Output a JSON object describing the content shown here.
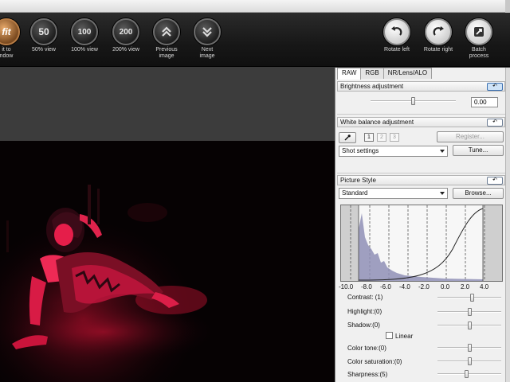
{
  "toolbar": {
    "left_tools": [
      {
        "icon": "fit-icon",
        "glyph": "fit",
        "label": "it to\nndow"
      },
      {
        "icon": "view-50-icon",
        "glyph": "50",
        "label": "50% view"
      },
      {
        "icon": "view-100-icon",
        "glyph": "100",
        "label": "100% view"
      },
      {
        "icon": "view-200-icon",
        "glyph": "200",
        "label": "200% view"
      },
      {
        "icon": "previous-image-icon",
        "glyph": "up-chevrons",
        "label": "Previous\nimage"
      },
      {
        "icon": "next-image-icon",
        "glyph": "down-chevrons",
        "label": "Next\nimage"
      }
    ],
    "right_tools": [
      {
        "icon": "rotate-left-icon",
        "label": "Rotate left"
      },
      {
        "icon": "rotate-right-icon",
        "label": "Rotate right"
      },
      {
        "icon": "batch-process-icon",
        "label": "Batch\nprocess"
      }
    ]
  },
  "panel": {
    "tabs": [
      "RAW",
      "RGB",
      "NR/Lens/ALO"
    ],
    "active_tab": "RAW",
    "brightness": {
      "title": "Brightness adjustment",
      "value": "0.00",
      "reset_symbol": "↶"
    },
    "white_balance": {
      "title": "White balance adjustment",
      "reset_symbol": "↶",
      "eyedropper_icon": "eyedropper-icon",
      "slots": [
        "1",
        "2",
        "3"
      ],
      "register_label": "Register...",
      "mode": "Shot settings",
      "tune_label": "Tune..."
    },
    "picture_style": {
      "title": "Picture Style",
      "reset_symbol": "↶",
      "style": "Standard",
      "browse_label": "Browse...",
      "histogram_axis": [
        "-10.0",
        "-8.0",
        "-6.0",
        "-4.0",
        "-2.0",
        "0.0",
        "2.0",
        "4.0"
      ],
      "properties": {
        "contrast": "Contrast: (1)",
        "highlight": "Highlight:(0)",
        "shadow": "Shadow:(0)",
        "linear": "Linear",
        "color_tone": "Color tone:(0)",
        "color_saturation": "Color saturation:(0)",
        "sharpness": "Sharpness:(5)"
      },
      "slider_levels": {
        "contrast": 0.55,
        "highlight": 0.5,
        "shadow": 0.5,
        "color_tone": 0.5,
        "color_saturation": 0.5,
        "sharpness": 0.45
      }
    },
    "brightness_level": 0.5
  },
  "colors": {
    "toolbar_bg": "#1a1a1a",
    "panel_bg": "#f0f0f0",
    "photo_accent": "#e0104a",
    "histogram_fill": "#8f8fb6"
  }
}
